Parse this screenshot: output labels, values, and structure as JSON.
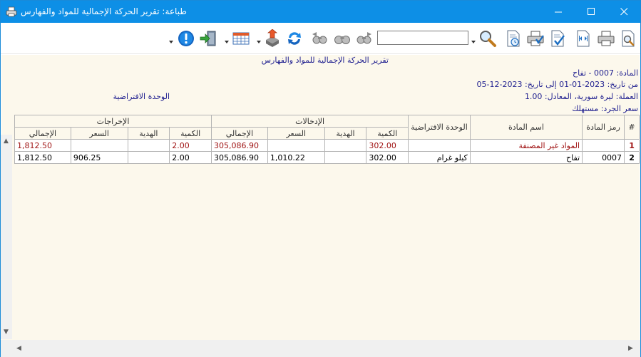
{
  "window": {
    "title": "طباعة: تقرير الحركة الإجمالية للمواد والفهارس"
  },
  "toolbar": {
    "search_value": ""
  },
  "report": {
    "heading": "تقرير الحركة الإجمالية للمواد والفهارس",
    "material_line": "المادة: 0007 - تفاح",
    "date_line": "من تاريخ: 2023-01-01 إلى تاريخ: 2023-12-05",
    "currency_line": "العملة: ليرة سورية، المعادل: 1.00",
    "default_unit_label": "الوحدة الافتراضية",
    "inventory_price_line": "سعر الجرد: مستهلك"
  },
  "table": {
    "group_headers": {
      "inputs": "الإدخالات",
      "outputs": "الإخراجات"
    },
    "headers": {
      "index": "#",
      "code": "رمز المادة",
      "name": "اسم المادة",
      "unit": "الوحدة الافتراضية",
      "in_qty": "الكمية",
      "in_gift": "الهدية",
      "in_price": "السعر",
      "in_total": "الإجمالي",
      "out_qty": "الكمية",
      "out_gift": "الهدية",
      "out_price": "السعر",
      "out_total": "الإجمالي"
    },
    "rows": [
      {
        "index": "1",
        "code": "",
        "name": "المواد غير المصنفة",
        "unit": "",
        "in_qty": "302.00",
        "in_gift": "",
        "in_price": "",
        "in_total": "305,086.90",
        "out_qty": "2.00",
        "out_gift": "",
        "out_price": "",
        "out_total": "1,812.50"
      },
      {
        "index": "2",
        "code": "0007",
        "name": "تفاح",
        "unit": "كيلو غرام",
        "in_qty": "302.00",
        "in_gift": "",
        "in_price": "1,010.22",
        "in_total": "305,086.90",
        "out_qty": "2.00",
        "out_gift": "",
        "out_price": "906.25",
        "out_total": "1,812.50"
      }
    ]
  },
  "colors": {
    "titlebar": "#0d8fe6",
    "report_bg": "#fcf8ec",
    "label_text": "#1f1f8f",
    "group_row_text": "#a01414"
  },
  "icons": {
    "app": "printer-icon",
    "minimize": "minimize-icon",
    "maximize": "maximize-icon",
    "close": "close-icon"
  }
}
